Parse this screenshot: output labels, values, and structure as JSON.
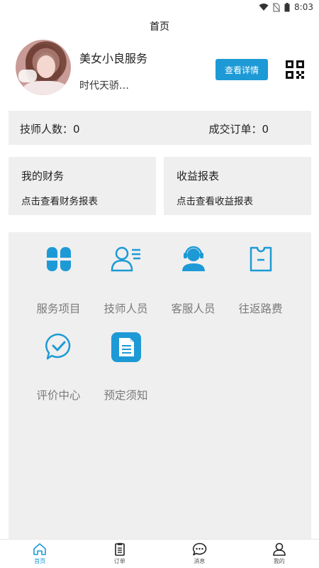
{
  "status_bar": {
    "time": "8:03"
  },
  "header": {
    "title": "首页"
  },
  "profile": {
    "name": "美女小良服务",
    "description": "时代天骄…",
    "detail_button": "查看详情"
  },
  "stats": {
    "technicians": "技师人数：0",
    "orders": "成交订单：0"
  },
  "panels": {
    "finance": {
      "title": "我的财务",
      "subtitle": "点击查看财务报表"
    },
    "report": {
      "title": "收益报表",
      "subtitle": "点击查看收益报表"
    }
  },
  "menu": [
    {
      "label": "服务项目",
      "icon": "clover-icon"
    },
    {
      "label": "技师人员",
      "icon": "staff-list-icon"
    },
    {
      "label": "客服人员",
      "icon": "headset-agent-icon"
    },
    {
      "label": "往返路费",
      "icon": "ticket-icon"
    },
    {
      "label": "评价中心",
      "icon": "check-bubble-icon"
    },
    {
      "label": "预定须知",
      "icon": "document-icon"
    }
  ],
  "bottom_nav": [
    {
      "label": "首页",
      "icon": "home-icon",
      "active": true
    },
    {
      "label": "订单",
      "icon": "clipboard-icon",
      "active": false
    },
    {
      "label": "消息",
      "icon": "chat-icon",
      "active": false
    },
    {
      "label": "我的",
      "icon": "person-icon",
      "active": false
    }
  ],
  "colors": {
    "accent": "#1d9ad6",
    "card_bg": "#efefef",
    "menu_label": "#7a7a7a"
  }
}
